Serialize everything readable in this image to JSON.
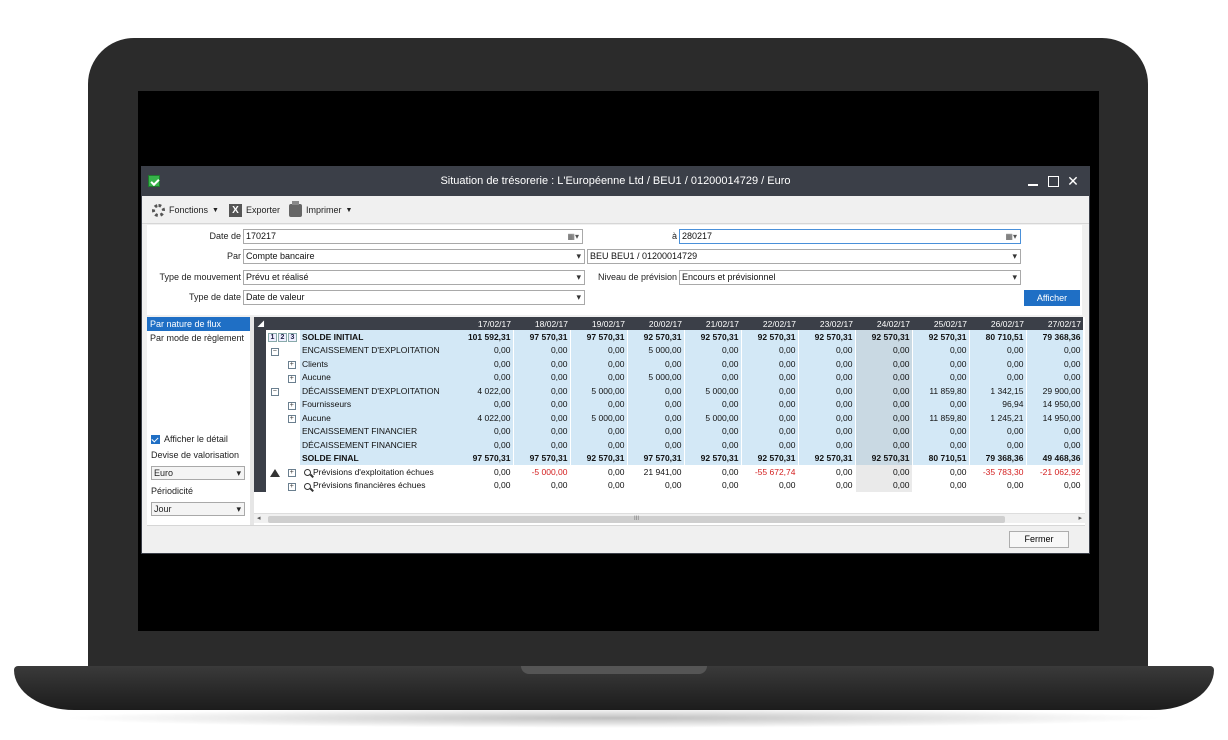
{
  "window": {
    "title": "Situation de trésorerie : L'Européenne Ltd / BEU1 / 01200014729 / Euro"
  },
  "toolbar": {
    "fonctions": "Fonctions",
    "exporter": "Exporter",
    "imprimer": "Imprimer"
  },
  "filters": {
    "date_de_label": "Date de",
    "date_de_value": "170217",
    "a_label": "à",
    "a_value": "280217",
    "par_label": "Par",
    "par_value": "Compte bancaire",
    "compte_value": "BEU  BEU1 / 01200014729",
    "type_mouvement_label": "Type de mouvement",
    "type_mouvement_value": "Prévu et réalisé",
    "niveau_label": "Niveau de prévision",
    "niveau_value": "Encours et prévisionnel",
    "type_date_label": "Type de date",
    "type_date_value": "Date de valeur",
    "afficher": "Afficher"
  },
  "left_panel": {
    "nav": [
      "Par nature de flux",
      "Par mode de règlement"
    ],
    "afficher_detail": "Afficher le détail",
    "devise_label": "Devise de valorisation",
    "devise_value": "Euro",
    "periodicite_label": "Périodicité",
    "periodicite_value": "Jour"
  },
  "grid": {
    "dates": [
      "17/02/17",
      "18/02/17",
      "19/02/17",
      "20/02/17",
      "21/02/17",
      "22/02/17",
      "23/02/17",
      "24/02/17",
      "25/02/17",
      "26/02/17",
      "27/02/17"
    ],
    "level_buttons": [
      "1",
      "2",
      "3"
    ],
    "rows": [
      {
        "label": "SOLDE INITIAL",
        "values": [
          "101 592,31",
          "97 570,31",
          "97 570,31",
          "92 570,31",
          "92 570,31",
          "92 570,31",
          "92 570,31",
          "92 570,31",
          "92 570,31",
          "80 710,51",
          "79 368,36"
        ]
      },
      {
        "label": "ENCAISSEMENT D'EXPLOITATION",
        "values": [
          "0,00",
          "0,00",
          "0,00",
          "5 000,00",
          "0,00",
          "0,00",
          "0,00",
          "0,00",
          "0,00",
          "0,00",
          "0,00"
        ]
      },
      {
        "label": "Clients",
        "values": [
          "0,00",
          "0,00",
          "0,00",
          "0,00",
          "0,00",
          "0,00",
          "0,00",
          "0,00",
          "0,00",
          "0,00",
          "0,00"
        ]
      },
      {
        "label": "Aucune",
        "values": [
          "0,00",
          "0,00",
          "0,00",
          "5 000,00",
          "0,00",
          "0,00",
          "0,00",
          "0,00",
          "0,00",
          "0,00",
          "0,00"
        ]
      },
      {
        "label": "DÉCAISSEMENT D'EXPLOITATION",
        "values": [
          "4 022,00",
          "0,00",
          "5 000,00",
          "0,00",
          "5 000,00",
          "0,00",
          "0,00",
          "0,00",
          "11 859,80",
          "1 342,15",
          "29 900,00"
        ]
      },
      {
        "label": "Fournisseurs",
        "values": [
          "0,00",
          "0,00",
          "0,00",
          "0,00",
          "0,00",
          "0,00",
          "0,00",
          "0,00",
          "0,00",
          "96,94",
          "14 950,00"
        ]
      },
      {
        "label": "Aucune",
        "values": [
          "4 022,00",
          "0,00",
          "5 000,00",
          "0,00",
          "5 000,00",
          "0,00",
          "0,00",
          "0,00",
          "11 859,80",
          "1 245,21",
          "14 950,00"
        ]
      },
      {
        "label": "ENCAISSEMENT FINANCIER",
        "values": [
          "0,00",
          "0,00",
          "0,00",
          "0,00",
          "0,00",
          "0,00",
          "0,00",
          "0,00",
          "0,00",
          "0,00",
          "0,00"
        ]
      },
      {
        "label": "DÉCAISSEMENT FINANCIER",
        "values": [
          "0,00",
          "0,00",
          "0,00",
          "0,00",
          "0,00",
          "0,00",
          "0,00",
          "0,00",
          "0,00",
          "0,00",
          "0,00"
        ]
      },
      {
        "label": "SOLDE FINAL",
        "values": [
          "97 570,31",
          "97 570,31",
          "92 570,31",
          "97 570,31",
          "92 570,31",
          "92 570,31",
          "92 570,31",
          "92 570,31",
          "80 710,51",
          "79 368,36",
          "49 468,36"
        ]
      },
      {
        "label": "Prévisions d'exploitation échues",
        "values": [
          "0,00",
          "-5 000,00",
          "0,00",
          "21 941,00",
          "0,00",
          "-55 672,74",
          "0,00",
          "0,00",
          "0,00",
          "-35 783,30",
          "-21 062,92"
        ]
      },
      {
        "label": "Prévisions financières échues",
        "values": [
          "0,00",
          "0,00",
          "0,00",
          "0,00",
          "0,00",
          "0,00",
          "0,00",
          "0,00",
          "0,00",
          "0,00",
          "0,00"
        ]
      }
    ],
    "scroll_grip": "III"
  },
  "footer": {
    "fermer": "Fermer"
  },
  "colors": {
    "titlebar": "#3b3f48",
    "accent": "#1f6fc5",
    "row_highlight": "#d3e8f6",
    "negative": "#d42020"
  }
}
